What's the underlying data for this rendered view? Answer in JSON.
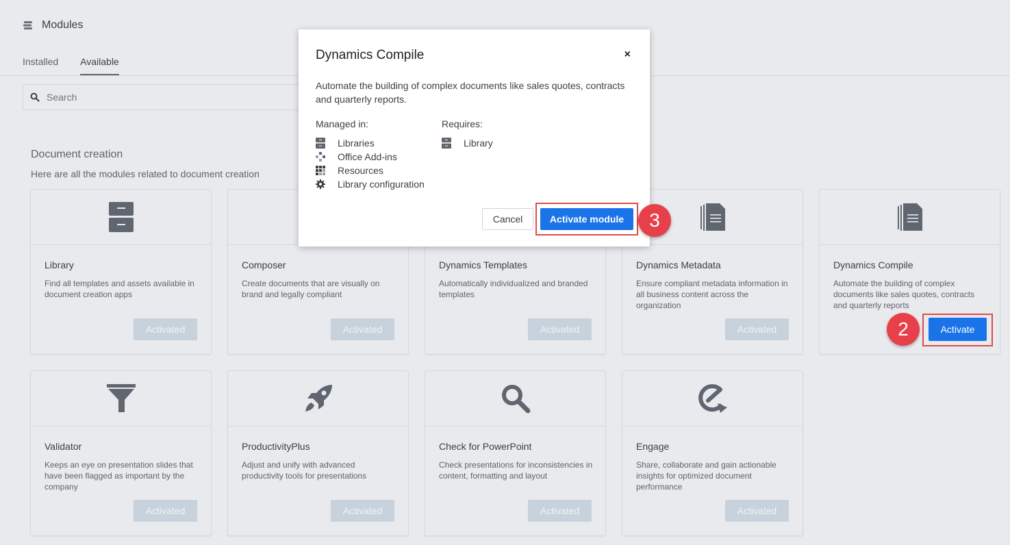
{
  "header": {
    "title": "Modules"
  },
  "tabs": [
    {
      "label": "Installed"
    },
    {
      "label": "Available"
    }
  ],
  "search": {
    "placeholder": "Search"
  },
  "section": {
    "title": "Document creation",
    "subtitle": "Here are all the modules related to document creation"
  },
  "cards": [
    {
      "title": "Library",
      "desc": "Find all templates and assets available in document creation apps",
      "button": "Activated",
      "icon": "library-icon"
    },
    {
      "title": "Composer",
      "desc": "Create documents that are visually on brand and legally compliant",
      "button": "Activated",
      "icon": "composer-icon"
    },
    {
      "title": "Dynamics Templates",
      "desc": "Automatically individualized and branded templates",
      "button": "Activated",
      "icon": "document-stack-icon"
    },
    {
      "title": "Dynamics Metadata",
      "desc": "Ensure compliant metadata information in all business content across the organization",
      "button": "Activated",
      "icon": "document-stack-icon"
    },
    {
      "title": "Dynamics Compile",
      "desc": "Automate the building of complex documents like sales quotes, contracts and quarterly reports",
      "button": "Activate",
      "icon": "document-stack-icon"
    },
    {
      "title": "Validator",
      "desc": "Keeps an eye on presentation slides that have been flagged as important by the company",
      "button": "Activated",
      "icon": "funnel-icon"
    },
    {
      "title": "ProductivityPlus",
      "desc": "Adjust and unify with advanced productivity tools for presentations",
      "button": "Activated",
      "icon": "rocket-icon"
    },
    {
      "title": "Check for PowerPoint",
      "desc": "Check presentations for inconsistencies in content, formatting and layout",
      "button": "Activated",
      "icon": "magnifier-icon"
    },
    {
      "title": "Engage",
      "desc": "Share, collaborate and gain actionable insights for optimized document performance",
      "button": "Activated",
      "icon": "engage-icon"
    }
  ],
  "dialog": {
    "title": "Dynamics Compile",
    "close": "×",
    "desc": "Automate the building of complex documents like sales quotes, contracts and quarterly reports.",
    "managed_label": "Managed in:",
    "managed": [
      "Libraries",
      "Office Add-ins",
      "Resources",
      "Library configuration"
    ],
    "requires_label": "Requires:",
    "requires": [
      "Library"
    ],
    "cancel": "Cancel",
    "activate": "Activate module"
  },
  "annotations": {
    "step2": "2",
    "step3": "3"
  },
  "colors": {
    "accent": "#1a73e8",
    "highlight": "#e24a4a",
    "badge": "#e8404a",
    "icon": "#5f6670"
  }
}
